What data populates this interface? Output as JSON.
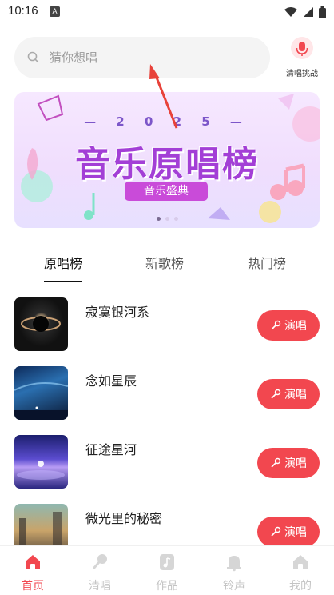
{
  "status": {
    "time": "10:16",
    "app_badge": "A"
  },
  "search": {
    "placeholder": "猜你想唱"
  },
  "challenge": {
    "label": "清唱挑战"
  },
  "banner": {
    "year": "— 2 0 2 5 —",
    "title": "音乐原唱榜",
    "subtitle": "音乐盛典",
    "pages": 3,
    "active_page": 1
  },
  "tabs": [
    {
      "label": "原唱榜",
      "active": true
    },
    {
      "label": "新歌榜",
      "active": false
    },
    {
      "label": "热门榜",
      "active": false
    }
  ],
  "songs": [
    {
      "title": "寂寞银河系",
      "action": "演唱"
    },
    {
      "title": "念如星辰",
      "action": "演唱"
    },
    {
      "title": "征途星河",
      "action": "演唱"
    },
    {
      "title": "微光里的秘密",
      "action": "演唱"
    }
  ],
  "nav": [
    {
      "label": "首页",
      "icon": "home-icon",
      "active": true
    },
    {
      "label": "清唱",
      "icon": "mic-icon",
      "active": false
    },
    {
      "label": "作品",
      "icon": "music-note-icon",
      "active": false
    },
    {
      "label": "铃声",
      "icon": "bell-icon",
      "active": false
    },
    {
      "label": "我的",
      "icon": "profile-home-icon",
      "active": false
    }
  ],
  "colors": {
    "accent": "#f2474f",
    "banner_purple": "#a33fd6"
  }
}
